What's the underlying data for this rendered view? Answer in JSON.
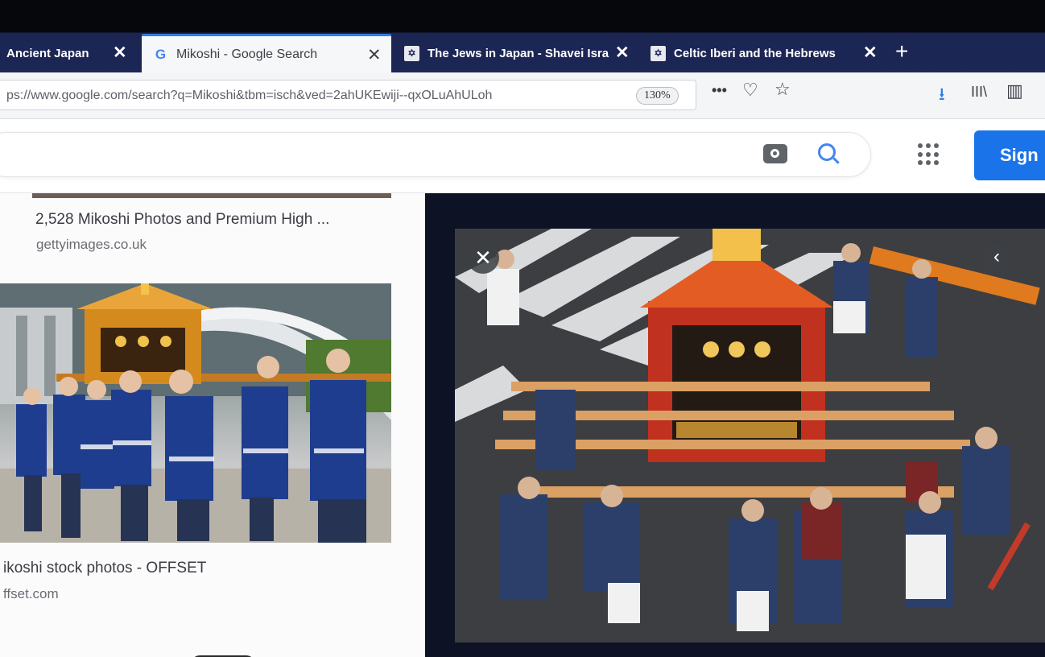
{
  "tabs": [
    {
      "label": "Ancient Japan",
      "close": "✕",
      "active": false
    },
    {
      "label": "Mikoshi - Google Search",
      "close": "✕",
      "active": true
    },
    {
      "label": "The Jews in Japan - Shavei Isra",
      "close": "✕",
      "active": false
    },
    {
      "label": "Celtic Iberi and the Hebrews",
      "close": "✕",
      "active": false
    }
  ],
  "new_tab_label": "+",
  "toolbar": {
    "url": "ps://www.google.com/search?q=Mikoshi&tbm=isch&ved=2ahUKEwiji--qxOLuAhULoh",
    "zoom": "130%",
    "more_label": "•••",
    "pocket_label": "♡",
    "bookmark_label": "☆",
    "download_label": "⭳",
    "library_label": "III\\",
    "sidebar_label": "▥"
  },
  "header": {
    "signin_label": "Sign"
  },
  "results": [
    {
      "title": "2,528 Mikoshi Photos and Premium High ...",
      "domain": "gettyimages.co.uk"
    },
    {
      "title": "ikoshi stock photos - OFFSET",
      "domain": "ffset.com"
    }
  ],
  "preview": {
    "close_label": "✕",
    "prev_label": "‹"
  },
  "colors": {
    "tab_bar": "#1c2756",
    "active_tab": "#f6f7f9",
    "accent": "#2f7de1",
    "google_blue": "#1a73e8",
    "preview_bg": "#0d1224"
  }
}
